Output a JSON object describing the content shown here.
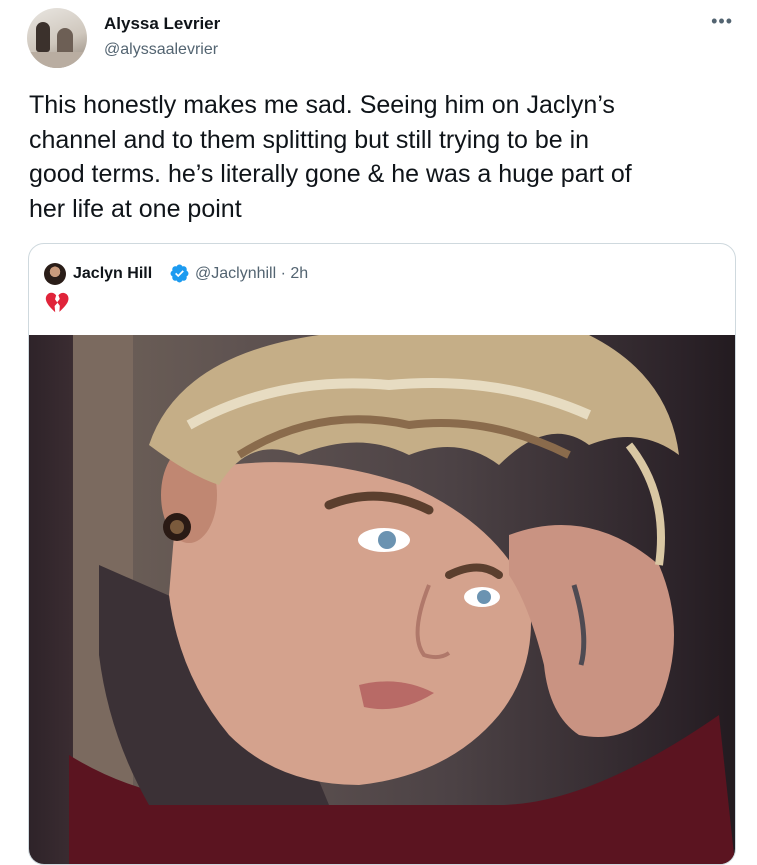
{
  "tweet": {
    "author_name": "Alyssa Levrier",
    "author_handle": "@alyssaalevrier",
    "more_icon": "more-horizontal-icon",
    "text": "This honestly makes me sad. Seeing him on Jaclyn’s\nchannel and to them splitting but still trying to be in\ngood terms. he’s literally gone & he was a huge part of\nher life at one point"
  },
  "quote": {
    "author_name": "Jaclyn Hill",
    "verified_icon": "verified-badge-icon",
    "handle_time": "@Jaclynhill · 2h",
    "emoji": "💔",
    "emoji_icon": "broken-heart-icon",
    "media_description_icon": "photo-portrait"
  },
  "colors": {
    "text_primary": "#0f1419",
    "text_secondary": "#536471",
    "verified_blue": "#1d9bf0",
    "border": "#cfd9de",
    "broken_heart_red": "#e0243a"
  }
}
